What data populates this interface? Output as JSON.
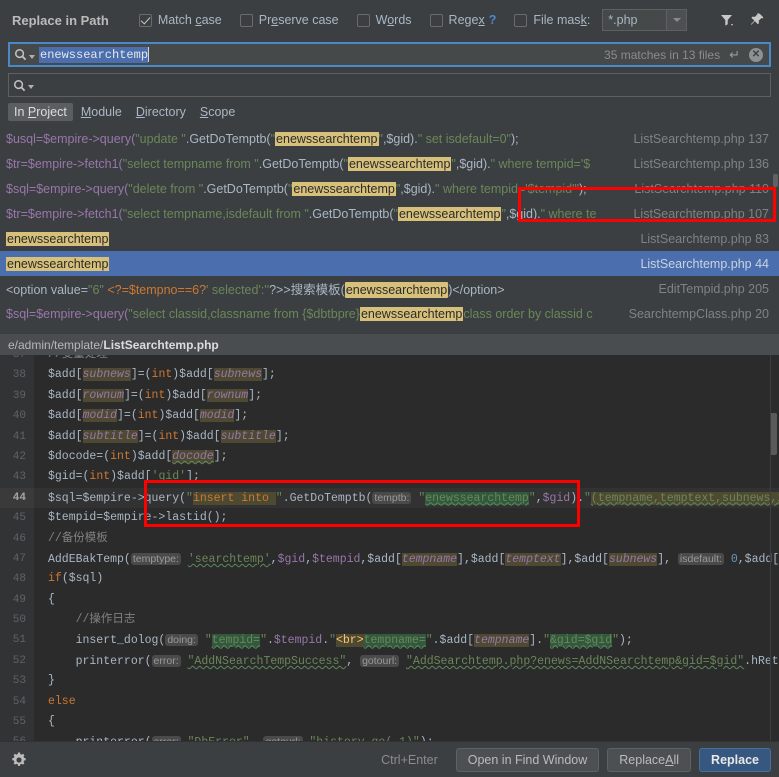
{
  "window": {
    "title": "Replace in Path"
  },
  "toolbar": {
    "options": [
      {
        "label": "Match case",
        "checked": true,
        "mnemonic": "c"
      },
      {
        "label": "Preserve case",
        "checked": false,
        "mnemonic": "e"
      },
      {
        "label": "Words",
        "checked": false,
        "mnemonic": "o"
      },
      {
        "label": "Regex",
        "checked": false,
        "mnemonic": "x",
        "help": "?"
      },
      {
        "label": "File mask:",
        "checked": false,
        "mnemonic": "k"
      }
    ],
    "file_mask_value": "*.php",
    "filter_icon": "filter-icon",
    "pin_icon": "pin-icon"
  },
  "search": {
    "value": "enewssearchtemp",
    "status": "35 matches in 13 files",
    "search_icon": "search-icon",
    "enter_icon": "return-icon",
    "clear_icon": "clear-icon"
  },
  "replace": {
    "value": "",
    "placeholder": "",
    "search_icon": "search-icon"
  },
  "scopes": [
    {
      "label": "In Project",
      "active": true,
      "mnemonic": "P"
    },
    {
      "label": "Module",
      "active": false,
      "mnemonic": "M"
    },
    {
      "label": "Directory",
      "active": false,
      "mnemonic": "D"
    },
    {
      "label": "Scope",
      "active": false,
      "mnemonic": "S"
    }
  ],
  "results": [
    {
      "selected": false,
      "location": "SearchtempClass.php 20",
      "parts": [
        {
          "t": "$sql=$empire->query(",
          "c": "var"
        },
        {
          "t": "\"select classid,classname from {$dbtbpre}",
          "c": "str"
        },
        {
          "t": "enewssearchtemp",
          "c": "hl"
        },
        {
          "t": "class order by classid c",
          "c": "str"
        }
      ]
    },
    {
      "selected": false,
      "location": "EditTempid.php 205",
      "parts": [
        {
          "t": "<option value=",
          "c": "pln"
        },
        {
          "t": "\"6\"",
          "c": "str"
        },
        {
          "t": " <?=$tempno==6?",
          "c": "kw"
        },
        {
          "t": "' selected':''",
          "c": "str"
        },
        {
          "t": "?>>搜索模板(",
          "c": "pln"
        },
        {
          "t": "enewssearchtemp",
          "c": "hl"
        },
        {
          "t": ")</option>",
          "c": "pln"
        }
      ]
    },
    {
      "selected": true,
      "location": "ListSearchtemp.php 44",
      "parts": [
        {
          "t": "enewssearchtemp",
          "c": "hl"
        }
      ]
    },
    {
      "selected": false,
      "location": "ListSearchtemp.php 83",
      "parts": [
        {
          "t": "enewssearchtemp",
          "c": "hl"
        }
      ]
    },
    {
      "selected": false,
      "location": "ListSearchtemp.php 107",
      "parts": [
        {
          "t": "$tr=$empire->fetch1(",
          "c": "var"
        },
        {
          "t": "\"select tempname,isdefault from \"",
          "c": "str"
        },
        {
          "t": ".GetDoTemptb(",
          "c": "pln"
        },
        {
          "t": "\"",
          "c": "str"
        },
        {
          "t": "enewssearchtemp",
          "c": "hl"
        },
        {
          "t": "\"",
          "c": "str"
        },
        {
          "t": ",$gid).",
          "c": "pln"
        },
        {
          "t": "\" where te",
          "c": "str"
        }
      ]
    },
    {
      "selected": false,
      "location": "ListSearchtemp.php 110",
      "parts": [
        {
          "t": "$sql=$empire->query(",
          "c": "var"
        },
        {
          "t": "\"delete from \"",
          "c": "str"
        },
        {
          "t": ".GetDoTemptb(",
          "c": "pln"
        },
        {
          "t": "\"",
          "c": "str"
        },
        {
          "t": "enewssearchtemp",
          "c": "hl"
        },
        {
          "t": "\"",
          "c": "str"
        },
        {
          "t": ",$gid).",
          "c": "pln"
        },
        {
          "t": "\" where tempid='$tempid'\"",
          "c": "str"
        },
        {
          "t": ");",
          "c": "pln"
        }
      ]
    },
    {
      "selected": false,
      "location": "ListSearchtemp.php 136",
      "parts": [
        {
          "t": "$tr=$empire->fetch1(",
          "c": "var"
        },
        {
          "t": "\"select tempname from \"",
          "c": "str"
        },
        {
          "t": ".GetDoTemptb(",
          "c": "pln"
        },
        {
          "t": "\"",
          "c": "str"
        },
        {
          "t": "enewssearchtemp",
          "c": "hl"
        },
        {
          "t": "\"",
          "c": "str"
        },
        {
          "t": ",$gid).",
          "c": "pln"
        },
        {
          "t": "\" where tempid='$",
          "c": "str"
        }
      ]
    },
    {
      "selected": false,
      "location": "ListSearchtemp.php 137",
      "parts": [
        {
          "t": "$usql=$empire->query(",
          "c": "var"
        },
        {
          "t": "\"update \"",
          "c": "str"
        },
        {
          "t": ".GetDoTemptb(",
          "c": "pln"
        },
        {
          "t": "\"",
          "c": "str"
        },
        {
          "t": "enewssearchtemp",
          "c": "hl"
        },
        {
          "t": "\"",
          "c": "str"
        },
        {
          "t": ",$gid).",
          "c": "pln"
        },
        {
          "t": "\" set isdefault=0\"",
          "c": "str"
        },
        {
          "t": ");",
          "c": "pln"
        }
      ]
    }
  ],
  "preview": {
    "path_prefix": "e/admin/template/",
    "path_file": "ListSearchtemp.php",
    "lines": [
      {
        "no": "37",
        "current": false,
        "html": "<span class=\"cmt\">//变量处理</span>"
      },
      {
        "no": "38",
        "current": false,
        "html": "$add[<span class=\"occ\"><i class=\"var\">subnews</i></span>]=(<span class=\"kw\">int</span>)$add[<span class=\"occ\"><i class=\"var\">subnews</i></span>];"
      },
      {
        "no": "39",
        "current": false,
        "html": "$add[<span class=\"occ\"><i class=\"var\">rownum</i></span>]=(<span class=\"kw\">int</span>)$add[<span class=\"occ\"><i class=\"var\">rownum</i></span>];"
      },
      {
        "no": "40",
        "current": false,
        "html": "$add[<span class=\"occ\"><i class=\"var\">modid</i></span>]=(<span class=\"kw\">int</span>)$add[<span class=\"occ\"><i class=\"var\">modid</i></span>];"
      },
      {
        "no": "41",
        "current": false,
        "html": "$add[<span class=\"occ\"><i class=\"var\">subtitle</i></span>]=(<span class=\"kw\">int</span>)$add[<span class=\"occ\"><i class=\"var\">subtitle</i></span>];"
      },
      {
        "no": "42",
        "current": false,
        "html": "$docode=(<span class=\"kw\">int</span>)$add[<span class=\"occ\"><i class=\"var wavy\">docode</i></span>];"
      },
      {
        "no": "43",
        "current": false,
        "html": "$gid=(<span class=\"kw\">int</span>)$add[<span class=\"str\">'gid'</span>];"
      },
      {
        "no": "44",
        "current": true,
        "html": "$sql=$empire-&gt;<span class=\"pln\">query</span>(<span class=\"str\">\"</span><span class=\"occ kw\">insert into </span><span class=\"str\">\"</span>.GetDoTemptb(<span class=\"param\">temptb:</span> <span class=\"str\">\"</span><span class=\"occ2 str wavy\">enewssearchtemp</span><span class=\"str\">\"</span>,<span class=\"var\">$gid</span>).<span class=\"str\">\"</span><span class=\"occ str wavy\">(tempname,temptext,subnews,isdefault,</span>"
      },
      {
        "no": "45",
        "current": false,
        "html": "$tempid=$empire-&gt;lastid();"
      },
      {
        "no": "46",
        "current": false,
        "html": "<span class=\"cmt\">//备份模板</span>"
      },
      {
        "no": "47",
        "current": false,
        "html": "AddEBakTemp(<span class=\"param\">temptype:</span> <span class=\"str wavy\">'searchtemp'</span>,<span class=\"var\">$gid</span>,<span class=\"var\">$tempid</span>,$add[<span class=\"occ\"><i class=\"var\">tempname</i></span>],$add[<span class=\"occ\"><i class=\"var\">temptext</i></span>],$add[<span class=\"occ\"><i class=\"var\">subnews</i></span>], <span class=\"param\">isdefault:</span> <span class=\"num\">0</span>,$add[<i class=\"var\">listvar</i>"
      },
      {
        "no": "48",
        "current": false,
        "html": "<span class=\"kw\">if</span>($sql)"
      },
      {
        "no": "49",
        "current": false,
        "html": "{"
      },
      {
        "no": "50",
        "current": false,
        "html": "&nbsp;&nbsp;&nbsp;&nbsp;<span class=\"cmt\">//操作日志</span>"
      },
      {
        "no": "51",
        "current": false,
        "html": "&nbsp;&nbsp;&nbsp;&nbsp;insert_dolog(<span class=\"param\">doing:</span> <span class=\"str\">\"</span><span class=\"occ2 str wavy\">tempid=</span><span class=\"str\">\"</span>.<span class=\"var\">$tempid</span>.<span class=\"str\">\"</span><span class=\"occ tag\">&lt;br&gt;</span><span class=\"occ2 str wavy\">tempname=</span><span class=\"str\">\"</span>.$add[<span class=\"occ\"><i class=\"var\">tempname</i></span>].<span class=\"str\">\"</span><span class=\"occ2 str wavy\">&amp;gid=$gid</span><span class=\"str\">\"</span>);"
      },
      {
        "no": "52",
        "current": false,
        "html": "&nbsp;&nbsp;&nbsp;&nbsp;printerror(<span class=\"param\">error:</span> <span class=\"str wavy\">\"AddNSearchTempSuccess\"</span>, <span class=\"param\">gotourl:</span> <span class=\"str wavy\">\"AddSearchtemp.php?enews=AddNSearchtemp&amp;gid=$gid\"</span>.hReturnEcmsH"
      },
      {
        "no": "53",
        "current": false,
        "html": "}"
      },
      {
        "no": "54",
        "current": false,
        "html": "<span class=\"kw\">else</span>"
      },
      {
        "no": "55",
        "current": false,
        "html": "{"
      },
      {
        "no": "56",
        "current": false,
        "html": "&nbsp;&nbsp;&nbsp;&nbsp;printerror(<span class=\"param\">error:</span> <span class=\"str wavy\">\"DbError\"</span>, <span class=\"param\">gotourl:</span> <span class=\"str wavy\">\"history.go(-1)\"</span>);"
      }
    ]
  },
  "bottom": {
    "settings_icon": "gear-icon",
    "shortcut": "Ctrl+Enter",
    "open_in_find_window": "Open in Find Window",
    "replace_all": "Replace All",
    "replace_all_mnemonic": "A",
    "replace": "Replace"
  },
  "colors": {
    "accent": "#4a88c7",
    "selection": "#4b6eaf",
    "highlight": "#d7c07a",
    "annotation": "#ff0000",
    "primary_button": "#365880"
  }
}
